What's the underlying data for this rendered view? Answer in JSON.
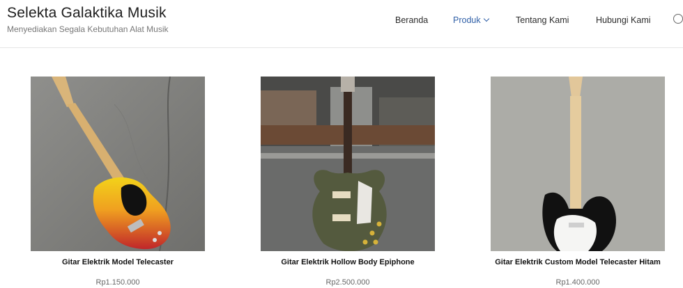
{
  "brand": {
    "title": "Selekta Galaktika Musik",
    "tagline": "Menyediakan Segala Kebutuhan Alat Musik"
  },
  "nav": {
    "items": [
      {
        "label": "Beranda"
      },
      {
        "label": "Produk",
        "active": true
      },
      {
        "label": "Tentang Kami"
      },
      {
        "label": "Hubungi Kami"
      }
    ],
    "search_icon": "search-icon"
  },
  "products": [
    {
      "name": "Gitar Elektrik Model Telecaster",
      "price": "Rp1.150.000"
    },
    {
      "name": "Gitar Elektrik Hollow Body Epiphone",
      "price": "Rp2.500.000"
    },
    {
      "name": "Gitar Elektrik Custom Model Telecaster Hitam",
      "price": "Rp1.400.000"
    }
  ],
  "colors": {
    "accent": "#2f5fa7",
    "text": "#222222",
    "muted": "#777777"
  }
}
